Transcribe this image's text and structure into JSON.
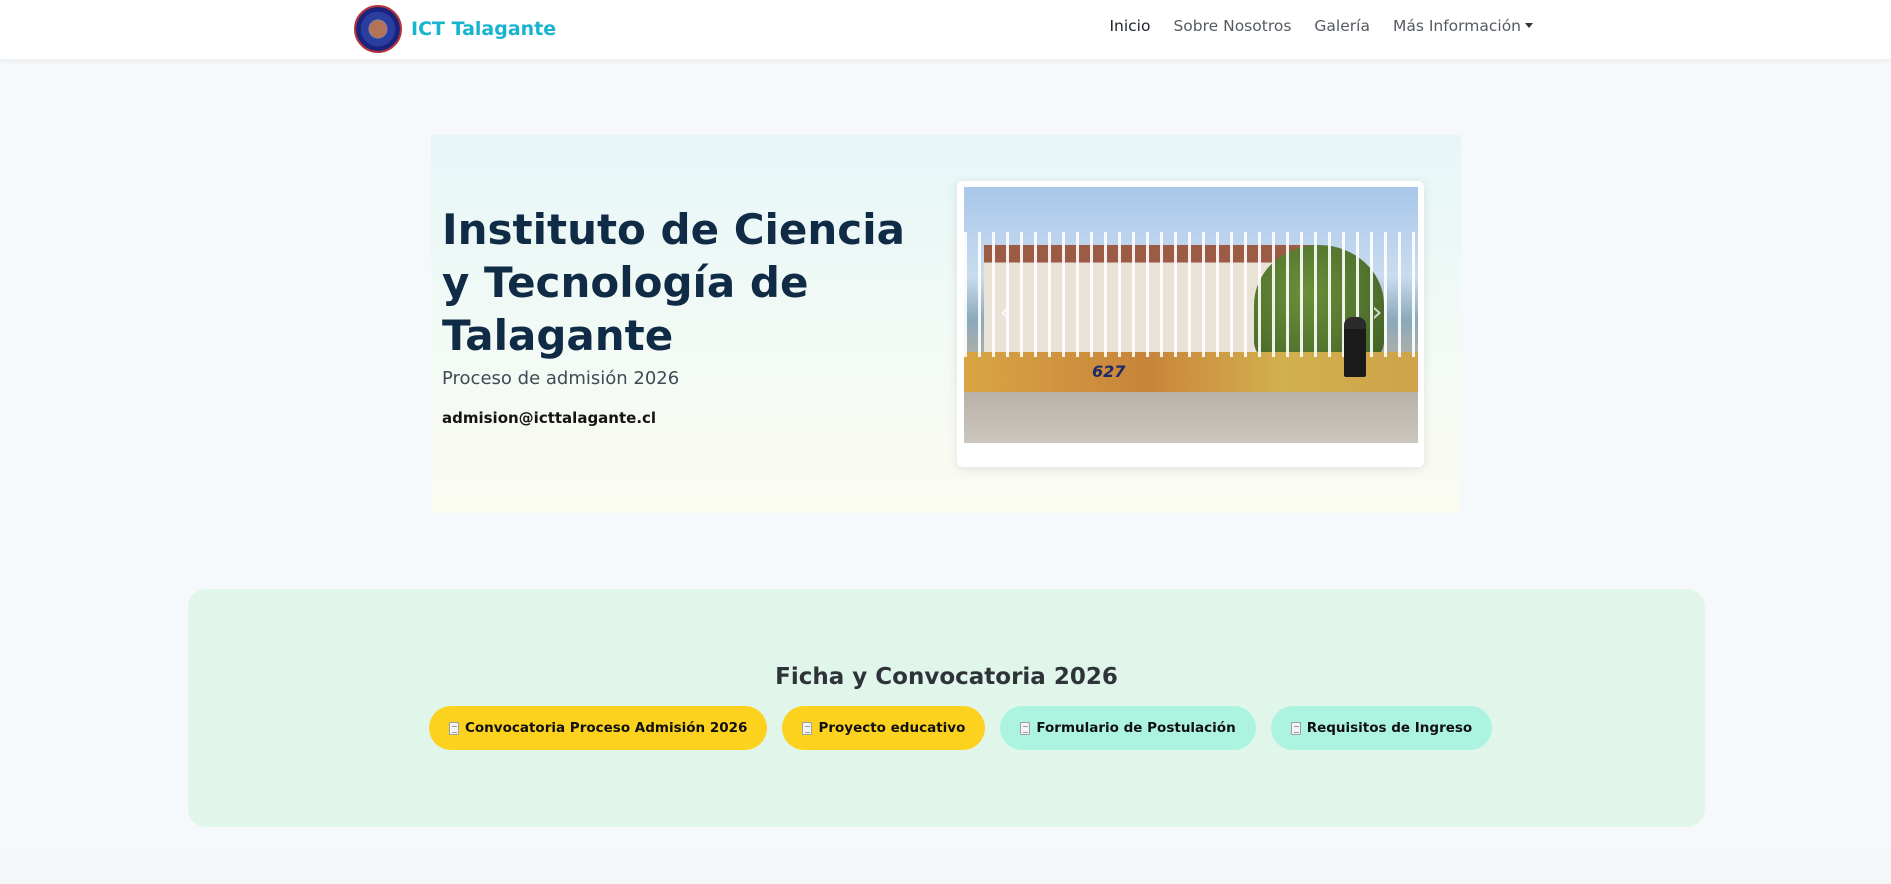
{
  "navbar": {
    "brand_name": "ICT Talagante",
    "links": [
      {
        "label": "Inicio",
        "active": true
      },
      {
        "label": "Sobre Nosotros",
        "active": false
      },
      {
        "label": "Galería",
        "active": false
      },
      {
        "label": "Más Información",
        "active": false,
        "dropdown": true
      }
    ]
  },
  "hero": {
    "title": "Instituto de Ciencia y Tecnología de Talagante",
    "subtitle": "Proceso de admisión 2026",
    "email": "admision@icttalagante.cl",
    "carousel": {
      "photo_text": "627",
      "prev_icon": "chevron-left-icon",
      "next_icon": "chevron-right-icon"
    }
  },
  "docs": {
    "title": "Ficha y Convocatoria 2026",
    "buttons": [
      {
        "label": "Convocatoria Proceso Admisión 2026",
        "color": "#fdd21f",
        "icon": "document-icon"
      },
      {
        "label": "Proyecto educativo",
        "color": "#fdd21f",
        "icon": "document-icon"
      },
      {
        "label": "Formulario de Postulación",
        "color": "#acf4e0",
        "icon": "document-icon"
      },
      {
        "label": "Requisitos de Ingreso",
        "color": "#acf4e0",
        "icon": "document-icon"
      }
    ]
  },
  "colors": {
    "brand": "#17b3cf",
    "hero_title": "#0f2b45",
    "docs_background": "#e0f6ea"
  }
}
